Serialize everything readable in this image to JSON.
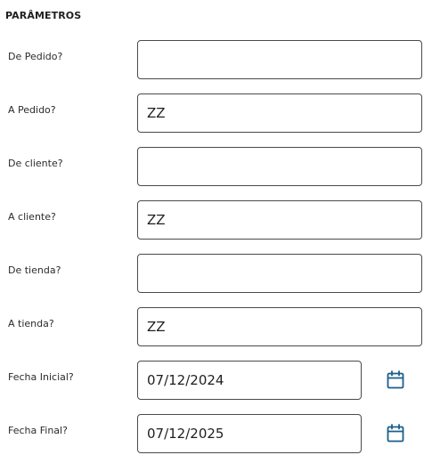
{
  "section": {
    "title": "PARÂMETROS"
  },
  "fields": [
    {
      "label": "De Pedido?",
      "value": ""
    },
    {
      "label": "A Pedido?",
      "value": "ZZ"
    },
    {
      "label": "De cliente?",
      "value": ""
    },
    {
      "label": "A cliente?",
      "value": "ZZ"
    },
    {
      "label": "De tienda?",
      "value": ""
    },
    {
      "label": "A tienda?",
      "value": "ZZ"
    },
    {
      "label": "Fecha Inicial?",
      "value": "07/12/2024",
      "icon": "calendar-icon"
    },
    {
      "label": "Fecha Final?",
      "value": "07/12/2025",
      "icon": "calendar-icon"
    }
  ],
  "colors": {
    "border": "#4a4a4a",
    "icon": "#1a5f8a",
    "text": "#1f1f1f"
  }
}
